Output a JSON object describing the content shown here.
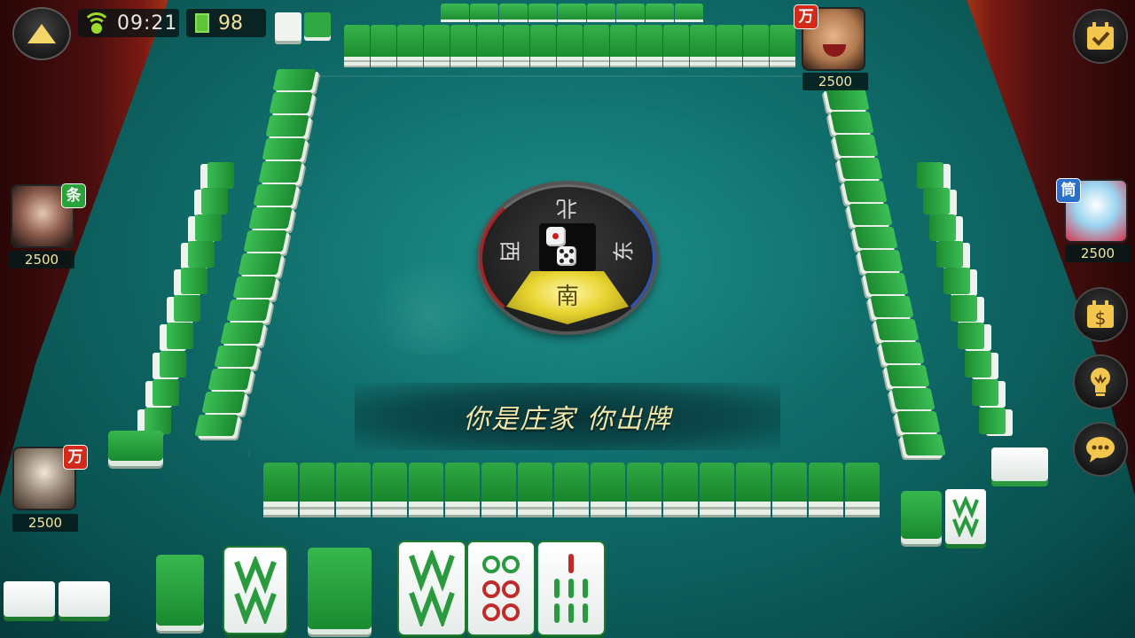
{
  "status_bar": {
    "time": "09:21",
    "remaining_tiles": "98"
  },
  "banner": {
    "text": "你是庄家  你出牌"
  },
  "compass": {
    "south": "南",
    "north": "北",
    "east": "东",
    "west": "西",
    "die1_value": 1,
    "die2_value": 5
  },
  "players": {
    "top_right": {
      "score": "2500",
      "suit": "万",
      "suit_color": "#d42a1a"
    },
    "left": {
      "score": "2500",
      "suit": "条",
      "suit_color": "#27a33a"
    },
    "right": {
      "score": "2500",
      "suit": "筒",
      "suit_color": "#2a70c8"
    },
    "self": {
      "score": "2500",
      "suit": "万",
      "suit_color": "#d42a1a"
    }
  },
  "right_buttons": [
    {
      "name": "tasks-button",
      "icon": "check-calendar-icon"
    },
    {
      "name": "shop-button",
      "icon": "money-bag-icon"
    },
    {
      "name": "hint-button",
      "icon": "lightbulb-icon"
    },
    {
      "name": "chat-button",
      "icon": "speech-bubble-icon"
    }
  ],
  "hand_tiles": [
    {
      "suit": "bamboo",
      "rank": 8
    },
    {
      "suit": "dots",
      "rank": 8
    },
    {
      "suit": "bamboo",
      "rank": 7
    }
  ],
  "colors": {
    "felt": "#0f6a68",
    "tile_green": "#2fa844",
    "score_gold": "#f2e7a0"
  }
}
